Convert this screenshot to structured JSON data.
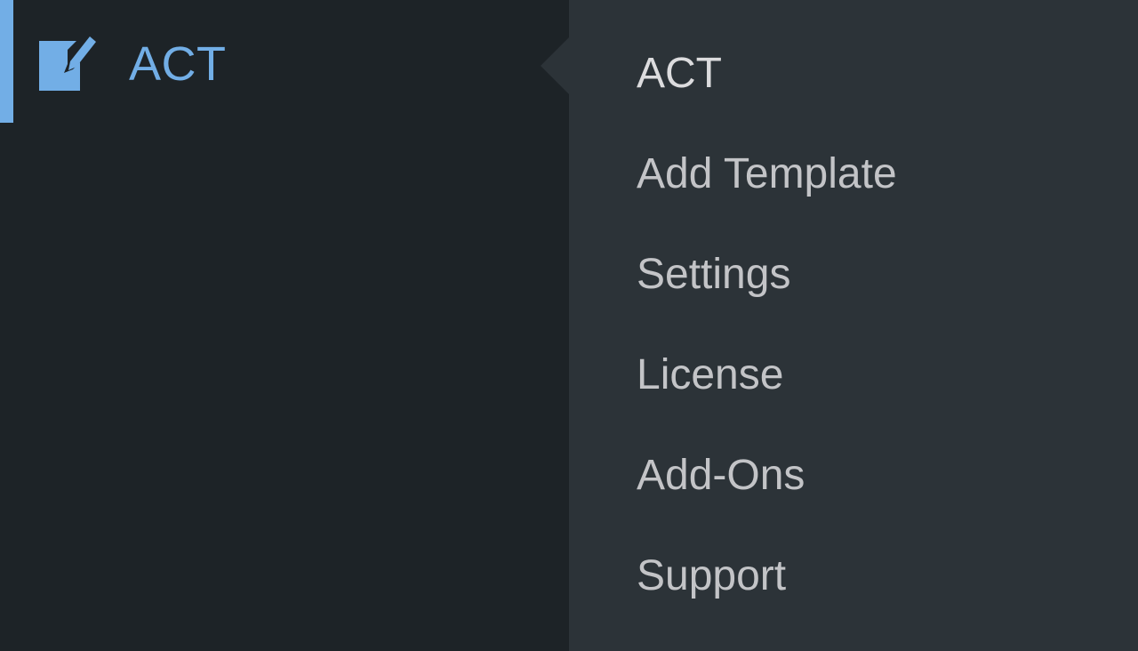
{
  "menu": {
    "label": "ACT",
    "icon": "edit-note-icon",
    "active_color": "#72aee6"
  },
  "submenu": {
    "items": [
      {
        "label": "ACT"
      },
      {
        "label": "Add Template"
      },
      {
        "label": "Settings"
      },
      {
        "label": "License"
      },
      {
        "label": "Add-Ons"
      },
      {
        "label": "Support"
      }
    ]
  },
  "colors": {
    "menu_bg": "#1d2327",
    "submenu_bg": "#2c3338",
    "submenu_text": "#c3c4c7"
  }
}
